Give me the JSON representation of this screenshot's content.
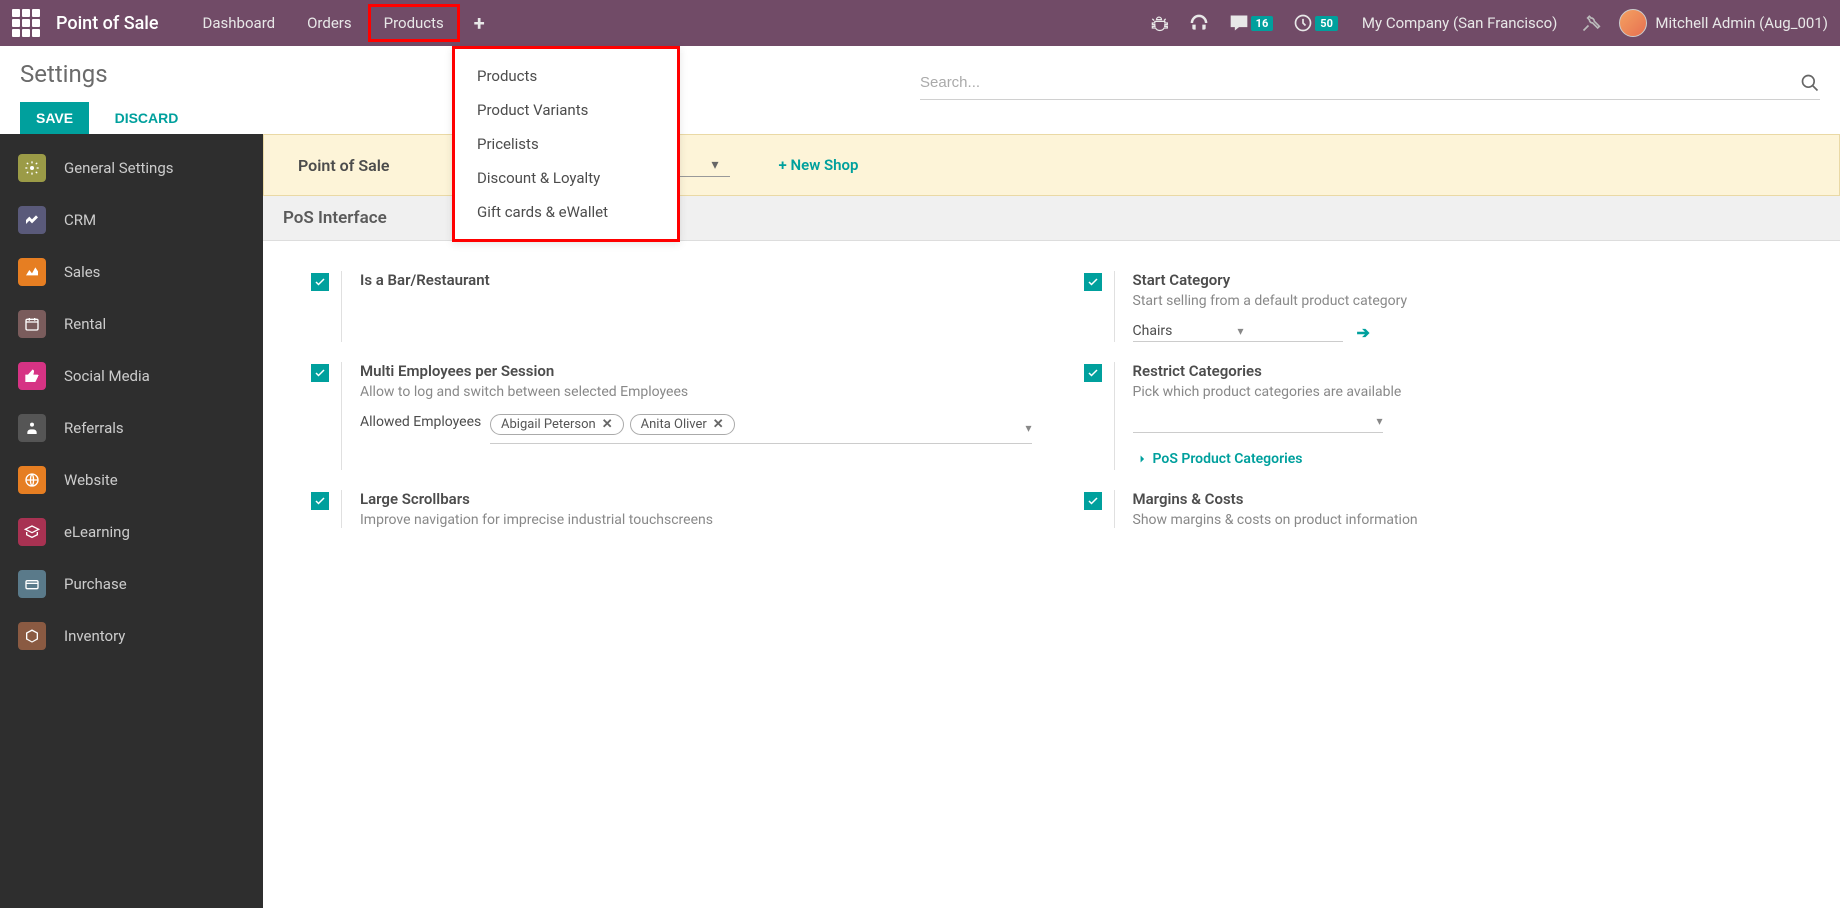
{
  "topbar": {
    "app_title": "Point of Sale",
    "menu": {
      "dashboard": "Dashboard",
      "orders": "Orders",
      "products": "Products"
    },
    "badges": {
      "messages": "16",
      "activities": "50"
    },
    "company": "My Company (San Francisco)",
    "username": "Mitchell Admin (Aug_001)"
  },
  "dropdown": {
    "products": "Products",
    "variants": "Product Variants",
    "pricelists": "Pricelists",
    "discount": "Discount & Loyalty",
    "gift": "Gift cards & eWallet"
  },
  "page": {
    "title": "Settings",
    "save": "SAVE",
    "discard": "DISCARD",
    "search_placeholder": "Search..."
  },
  "sidebar": {
    "general": "General Settings",
    "crm": "CRM",
    "sales": "Sales",
    "rental": "Rental",
    "social": "Social Media",
    "referrals": "Referrals",
    "website": "Website",
    "elearning": "eLearning",
    "purchase": "Purchase",
    "inventory": "Inventory"
  },
  "posbar": {
    "label": "Point of Sale",
    "new_shop": "+ New Shop"
  },
  "section": {
    "pos_interface": "PoS Interface"
  },
  "settings": {
    "bar": {
      "title": "Is a Bar/Restaurant"
    },
    "startcat": {
      "title": "Start Category",
      "desc": "Start selling from a default product category",
      "value": "Chairs"
    },
    "multi": {
      "title": "Multi Employees per Session",
      "desc": "Allow to log and switch between selected Employees",
      "field_label": "Allowed Employees",
      "emp1": "Abigail Peterson",
      "emp2": "Anita Oliver"
    },
    "restrict": {
      "title": "Restrict Categories",
      "desc": "Pick which product categories are available",
      "link": "PoS Product Categories"
    },
    "scroll": {
      "title": "Large Scrollbars",
      "desc": "Improve navigation for imprecise industrial touchscreens"
    },
    "margins": {
      "title": "Margins & Costs",
      "desc": "Show margins & costs on product information"
    }
  }
}
